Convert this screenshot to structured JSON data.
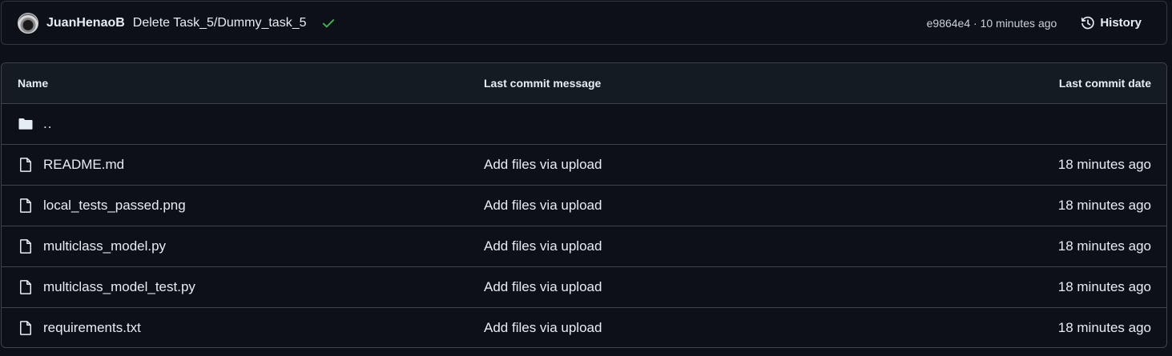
{
  "commit": {
    "author": "JuanHenaoB",
    "message": "Delete Task_5/Dummy_task_5",
    "status_icon": "check-icon",
    "status_color": "#3fb950",
    "sha_time": "e9864e4 · 10 minutes ago",
    "history_label": "History"
  },
  "table": {
    "headers": {
      "name": "Name",
      "message": "Last commit message",
      "date": "Last commit date"
    },
    "parent": {
      "label": "..",
      "icon": "folder-icon"
    },
    "rows": [
      {
        "name": "README.md",
        "message": "Add files via upload",
        "date": "18 minutes ago",
        "icon": "file-icon"
      },
      {
        "name": "local_tests_passed.png",
        "message": "Add files via upload",
        "date": "18 minutes ago",
        "icon": "file-icon"
      },
      {
        "name": "multiclass_model.py",
        "message": "Add files via upload",
        "date": "18 minutes ago",
        "icon": "file-icon"
      },
      {
        "name": "multiclass_model_test.py",
        "message": "Add files via upload",
        "date": "18 minutes ago",
        "icon": "file-icon"
      },
      {
        "name": "requirements.txt",
        "message": "Add files via upload",
        "date": "18 minutes ago",
        "icon": "file-icon"
      }
    ]
  }
}
